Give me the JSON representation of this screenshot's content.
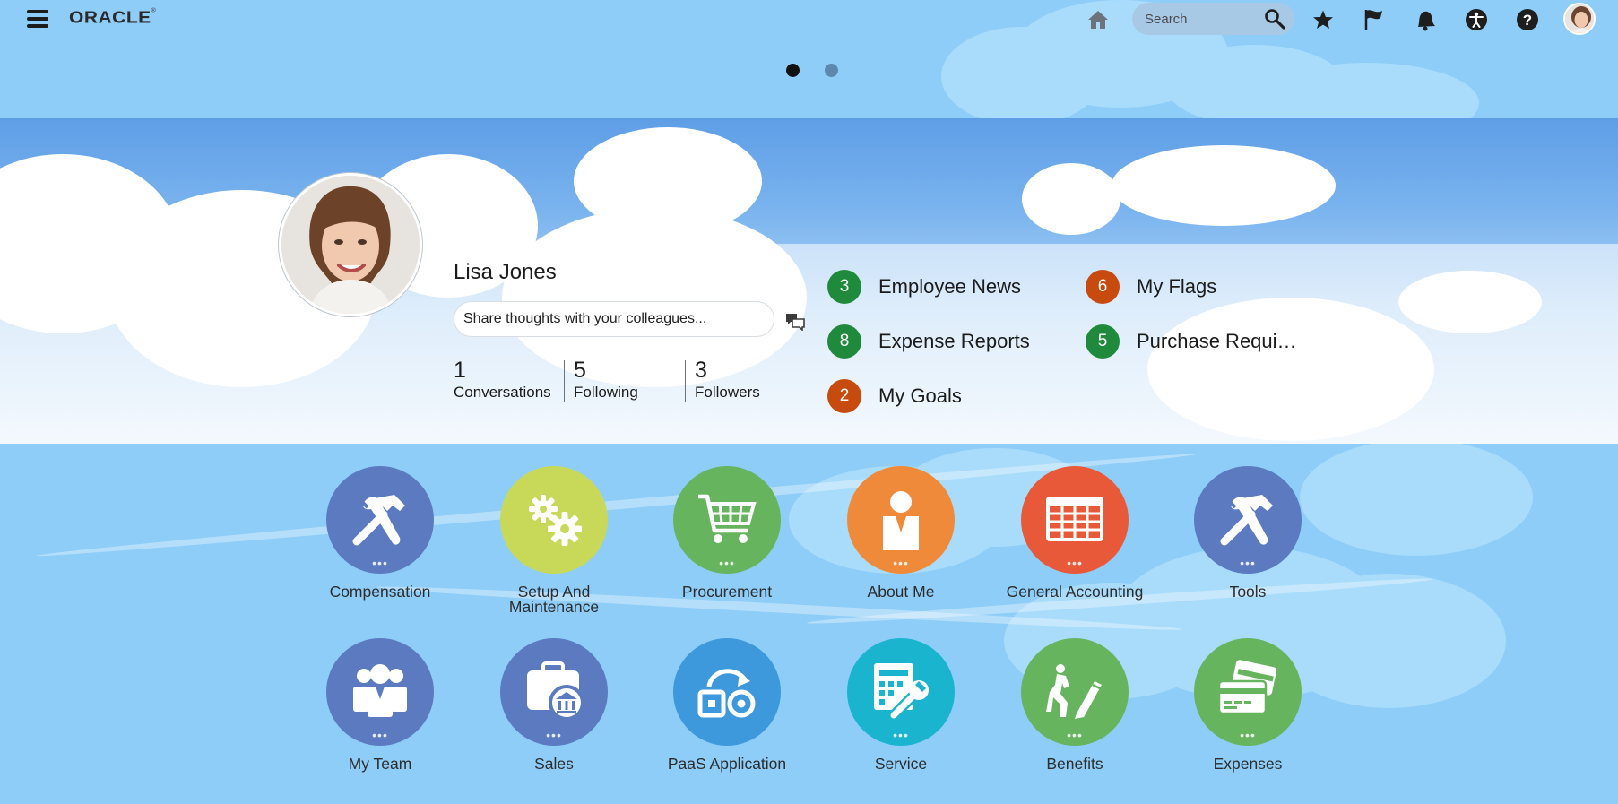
{
  "header": {
    "logo_text": "ORACLE",
    "search_placeholder": "Search",
    "icons": [
      "menu-icon",
      "home-icon",
      "search-icon",
      "star-icon",
      "flag-icon",
      "bell-icon",
      "accessibility-icon",
      "help-icon",
      "avatar"
    ]
  },
  "carousel": {
    "pages": 2,
    "active": 1
  },
  "profile": {
    "name": "Lisa Jones",
    "share_placeholder": "Share thoughts with your colleagues...",
    "stats": [
      {
        "value": "1",
        "label": "Conversations"
      },
      {
        "value": "5",
        "label": "Following"
      },
      {
        "value": "3",
        "label": "Followers"
      }
    ]
  },
  "notifications": [
    {
      "count": "3",
      "label": "Employee News",
      "color": "#1f8a3b"
    },
    {
      "count": "6",
      "label": "My Flags",
      "color": "#c74b0e"
    },
    {
      "count": "8",
      "label": "Expense Reports",
      "color": "#1f8a3b"
    },
    {
      "count": "5",
      "label": "Purchase Requi…",
      "color": "#1f8a3b"
    },
    {
      "count": "2",
      "label": "My Goals",
      "color": "#c74b0e"
    }
  ],
  "apps": [
    {
      "label": "Compensation",
      "color": "#5b7ac0",
      "icon": "tools-icon"
    },
    {
      "label": "Setup And Maintenance",
      "color": "#c8d95a",
      "icon": "gears-icon"
    },
    {
      "label": "Procurement",
      "color": "#67b45e",
      "icon": "cart-icon"
    },
    {
      "label": "About Me",
      "color": "#ee8a3a",
      "icon": "person-icon"
    },
    {
      "label": "General Accounting",
      "color": "#e8593a",
      "icon": "ledger-icon"
    },
    {
      "label": "Tools",
      "color": "#5b7ac0",
      "icon": "tools-icon"
    },
    {
      "label": "My Team",
      "color": "#5b7ac0",
      "icon": "team-icon"
    },
    {
      "label": "Sales",
      "color": "#5b7ac0",
      "icon": "briefcase-bank-icon"
    },
    {
      "label": "PaaS Application",
      "color": "#3d98dc",
      "icon": "paas-icon"
    },
    {
      "label": "Service",
      "color": "#1ab4cf",
      "icon": "service-icon"
    },
    {
      "label": "Benefits",
      "color": "#67b45e",
      "icon": "benefits-icon"
    },
    {
      "label": "Expenses",
      "color": "#67b45e",
      "icon": "cards-icon"
    }
  ],
  "colors": {
    "background": "#8ecdf8",
    "badge_green": "#1f8a3b",
    "badge_orange": "#c74b0e"
  }
}
